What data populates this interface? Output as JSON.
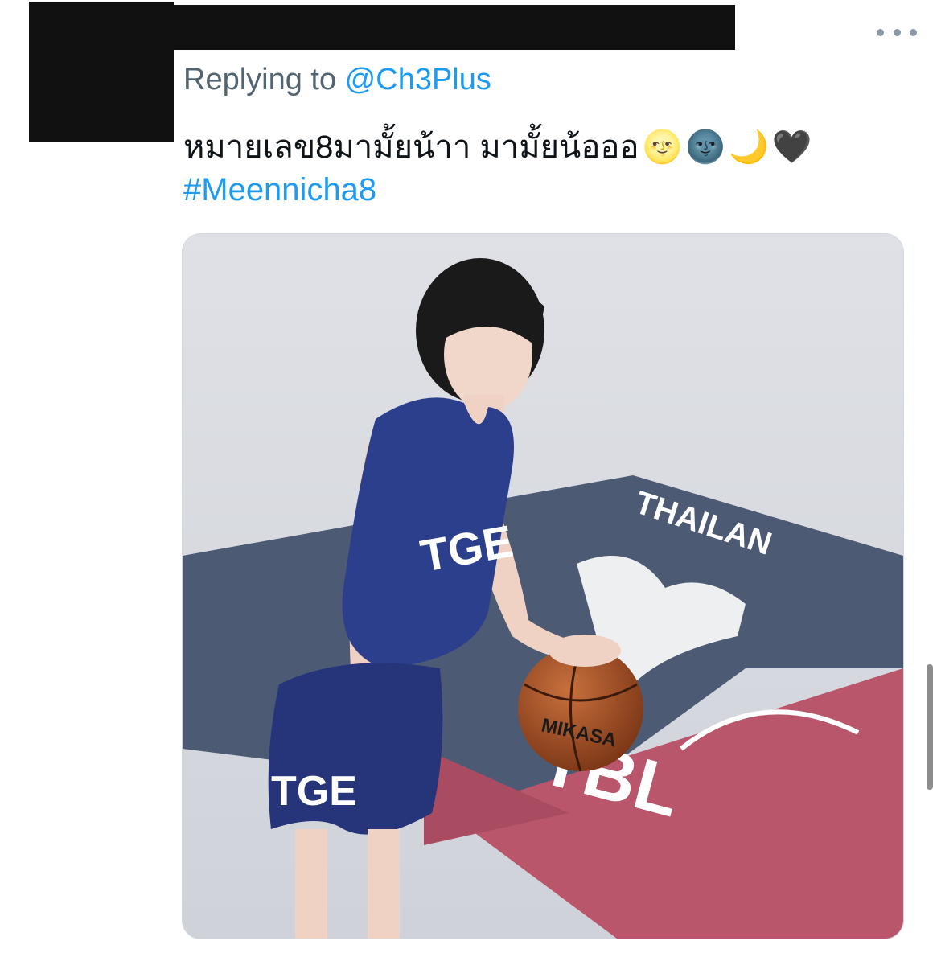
{
  "tweet": {
    "replying_to_prefix": "Replying to ",
    "replying_to_handle": "@Ch3Plus",
    "text": "หมายเลข8มามั้ยน้าา มามั้ยน้อออ",
    "emojis": [
      "🌝",
      "🌚",
      "🌙",
      "🖤"
    ],
    "hashtag": "#Meennicha8",
    "media": {
      "court_text": "THAILAN",
      "league_logo_text": "TBL",
      "ball_brand": "MIKASA",
      "jersey_text": "TGE",
      "shorts_text": "TGE"
    }
  },
  "colors": {
    "accent": "#1d9bf0",
    "secondary_text": "#536471",
    "primary_text": "#0f1419"
  }
}
